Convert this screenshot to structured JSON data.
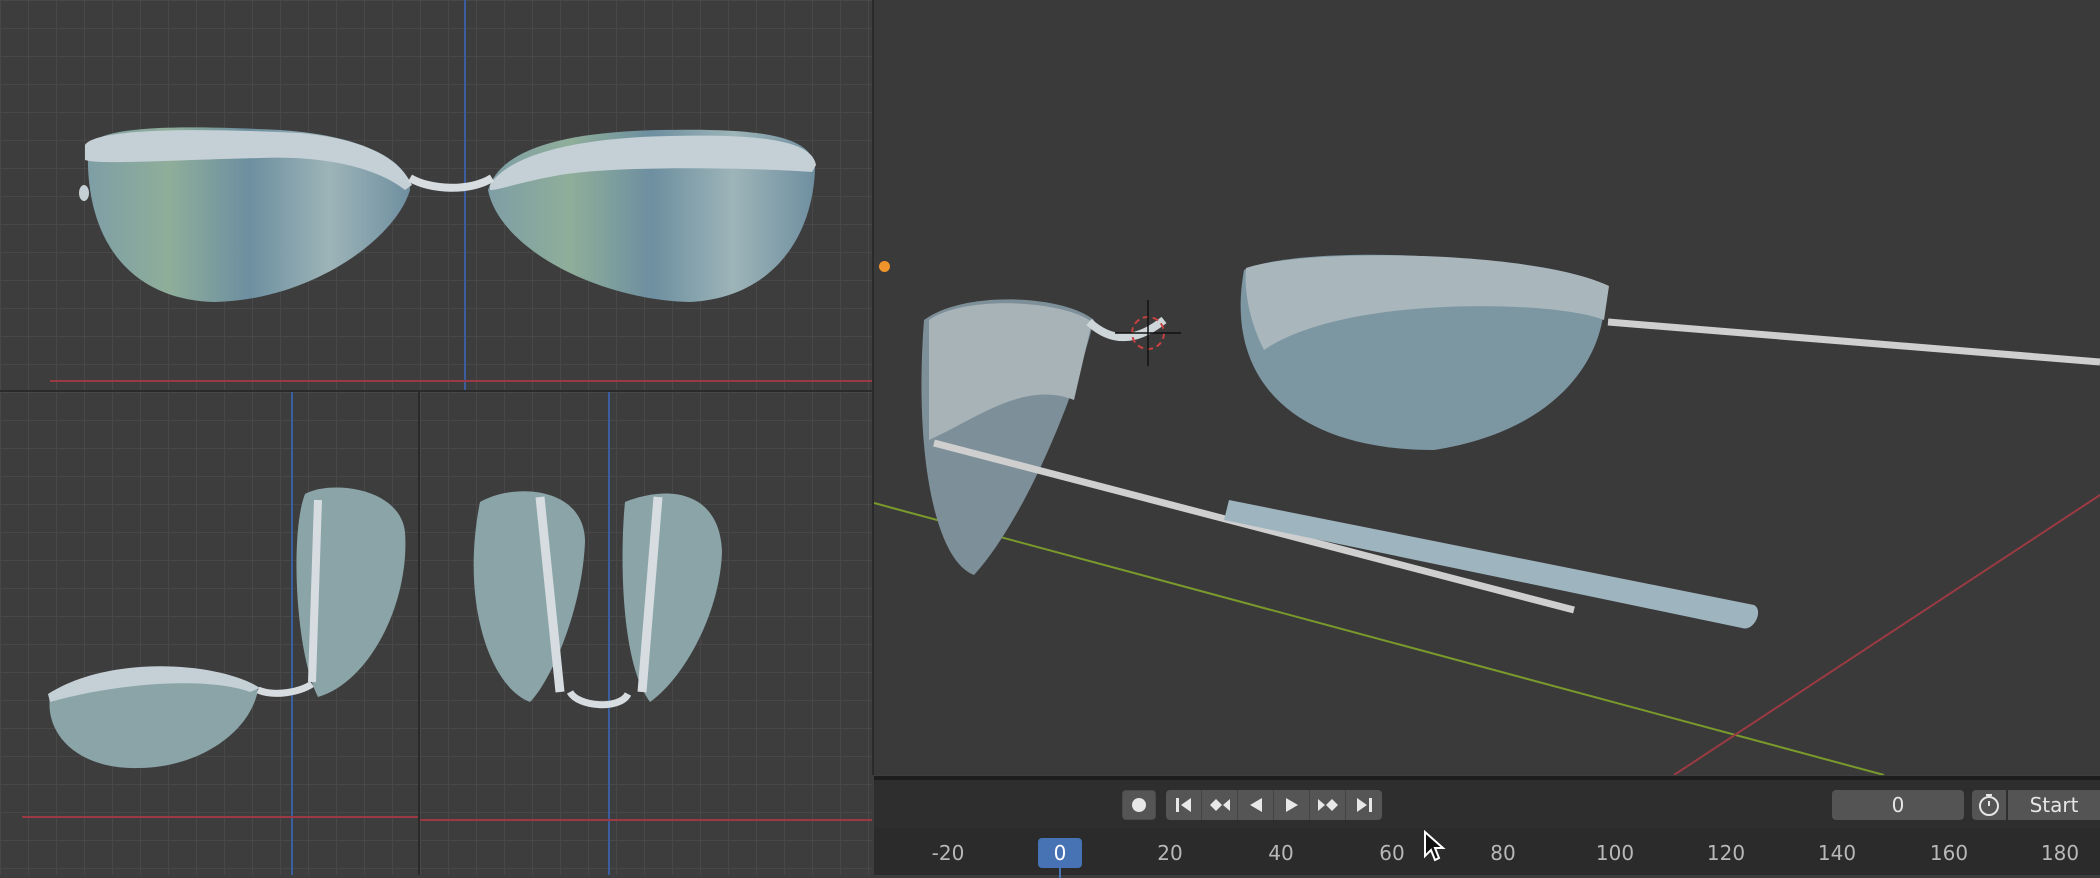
{
  "viewports": {
    "front": {
      "name": "front-orthographic-viewport"
    },
    "side": {
      "name": "side-orthographic-viewport"
    },
    "top": {
      "name": "top-orthographic-viewport"
    },
    "perspective": {
      "name": "perspective-viewport"
    }
  },
  "timeline": {
    "record_icon": "record-icon",
    "controls": [
      "jump-to-start-icon",
      "previous-keyframe-icon",
      "play-reverse-icon",
      "play-icon",
      "next-keyframe-icon",
      "jump-to-end-icon"
    ],
    "current_frame_value": "0",
    "start_label": "Start",
    "current_frame_marker": "0",
    "ruler_ticks": [
      "-20",
      "20",
      "40",
      "60",
      "80",
      "100",
      "120",
      "140",
      "160",
      "180"
    ]
  },
  "colors": {
    "accent_blue": "#4772b3",
    "axis_red": "#9b3a43",
    "axis_green": "#7a9a2c",
    "axis_blue": "#3a5f9c",
    "background": "#3d3d3d"
  }
}
